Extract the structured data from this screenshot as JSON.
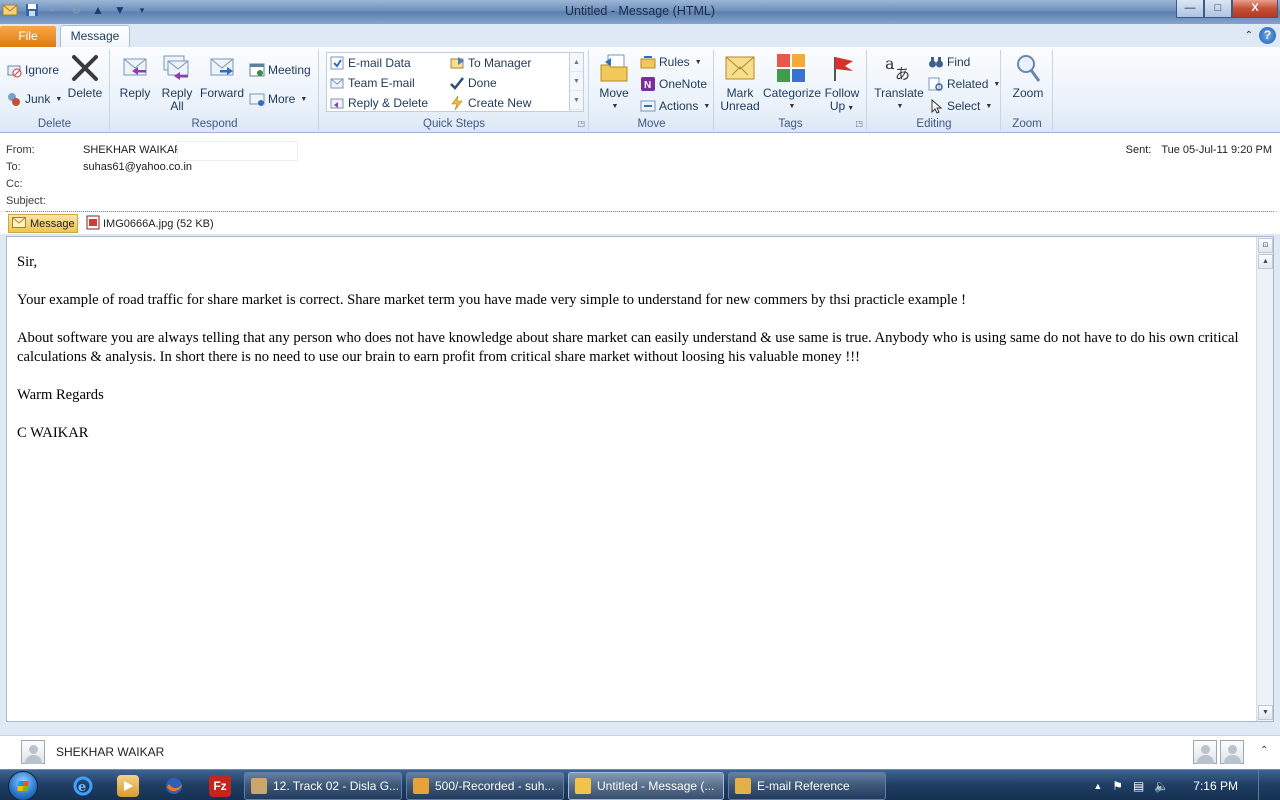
{
  "window": {
    "title": "Untitled  -  Message (HTML)",
    "controls": {
      "minimize": "—",
      "maximize": "□",
      "close": "X"
    }
  },
  "quick_access": [
    "save-icon",
    "undo-icon",
    "redo-icon",
    "up-arrow-icon",
    "down-arrow-icon",
    "customize-icon"
  ],
  "tabs": {
    "file": "File",
    "message": "Message"
  },
  "ribbon": {
    "delete": {
      "label": "Delete",
      "ignore": "Ignore",
      "junk": "Junk",
      "delete": "Delete"
    },
    "respond": {
      "label": "Respond",
      "reply": "Reply",
      "reply_all_1": "Reply",
      "reply_all_2": "All",
      "forward": "Forward",
      "meeting": "Meeting",
      "more": "More"
    },
    "quick_steps": {
      "label": "Quick Steps",
      "items": [
        "E-mail Data",
        "To Manager",
        "Team E-mail",
        "Done",
        "Reply & Delete",
        "Create New"
      ]
    },
    "move": {
      "label": "Move",
      "move": "Move",
      "rules": "Rules",
      "onenote": "OneNote",
      "actions": "Actions"
    },
    "tags": {
      "label": "Tags",
      "mark_unread_1": "Mark",
      "mark_unread_2": "Unread",
      "categorize": "Categorize",
      "follow_up_1": "Follow",
      "follow_up_2": "Up"
    },
    "editing": {
      "label": "Editing",
      "translate": "Translate",
      "find": "Find",
      "related": "Related",
      "select": "Select"
    },
    "zoom": {
      "label": "Zoom",
      "zoom": "Zoom"
    }
  },
  "header": {
    "from_label": "From:",
    "from_value": "SHEKHAR WAIKAR",
    "to_label": "To:",
    "to_value": "suhas61@yahoo.co.in",
    "cc_label": "Cc:",
    "subject_label": "Subject:",
    "sent_label": "Sent:",
    "sent_value": "Tue 05-Jul-11 9:20 PM"
  },
  "attachments": {
    "message_tab": "Message",
    "file": "IMG0666A.jpg (52 KB)"
  },
  "body": {
    "paragraphs": [
      "Sir,",
      "Your example of road traffic for  share market is correct. Share market term you have made very simple to understand  for new commers by thsi practicle example !",
      "About software you are always telling that any person  who does  not have knowledge about share market can easily understand & use same is true. Anybody who is using same do not have to do  his own critical calculations & analysis. In short there is no need to use our brain  to earn  profit  from  critical share market without loosing his valuable money !!!",
      "Warm Regards",
      "C  WAIKAR"
    ]
  },
  "people_pane": {
    "name": "SHEKHAR WAIKAR"
  },
  "taskbar": {
    "tasks": [
      {
        "label": "12. Track 02 - Disla G...",
        "color": "#c9a66b"
      },
      {
        "label": "500/-Recorded - suh...",
        "color": "#e8a23a"
      },
      {
        "label": "Untitled - Message (...",
        "color": "#f1c54c"
      },
      {
        "label": "E-mail Reference",
        "color": "#e2b24a"
      }
    ],
    "clock": "7:16 PM"
  },
  "colors": {
    "accent_file_tab": "#e27811",
    "ribbon_bg": "#eaf1fa",
    "taskbar": "#1f3d63"
  }
}
